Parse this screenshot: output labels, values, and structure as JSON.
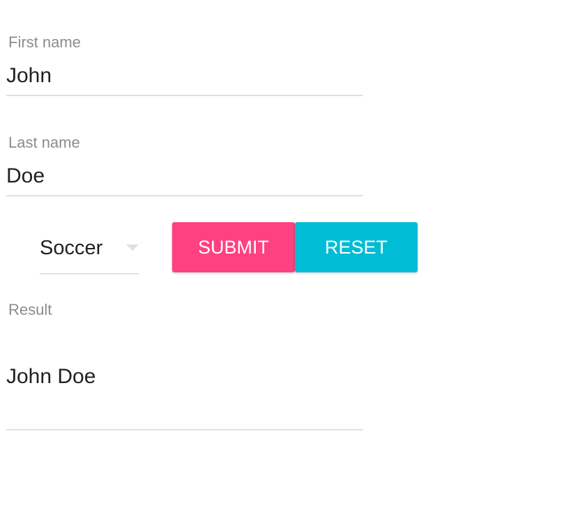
{
  "form": {
    "first_name": {
      "label": "First name",
      "value": "John"
    },
    "last_name": {
      "label": "Last name",
      "value": "Doe"
    },
    "sport_select": {
      "selected": "Soccer"
    },
    "buttons": {
      "submit_label": "SUBMIT",
      "reset_label": "RESET"
    },
    "result": {
      "label": "Result",
      "value": "John Doe"
    }
  },
  "colors": {
    "submit_bg": "#ff4081",
    "reset_bg": "#00bcd4",
    "label": "#8c8c8c",
    "text": "#212121",
    "underline": "#e0e0e0"
  },
  "icons": {
    "select_arrow": "caret-down-icon"
  }
}
